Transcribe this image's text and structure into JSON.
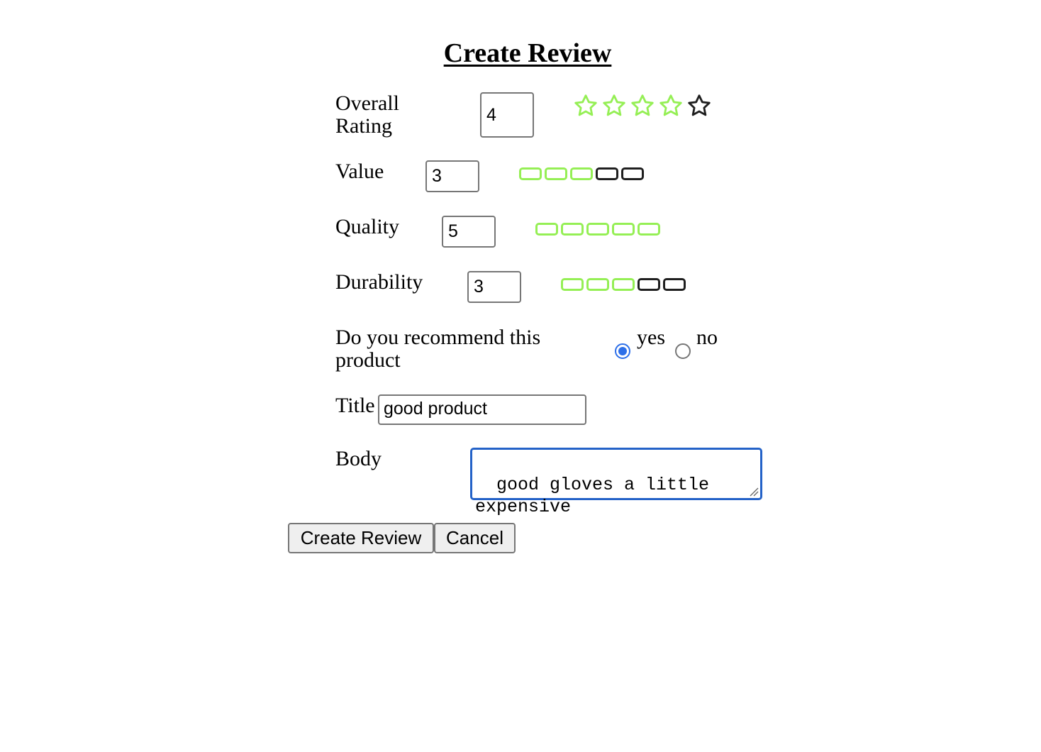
{
  "page": {
    "title": "Create Review"
  },
  "form": {
    "overall": {
      "label": "Overall Rating",
      "value": "4",
      "rating": 4,
      "max": 5
    },
    "value": {
      "label": "Value",
      "value": "3",
      "rating": 3,
      "max": 5
    },
    "quality": {
      "label": "Quality",
      "value": "5",
      "rating": 5,
      "max": 5
    },
    "durability": {
      "label": "Durability",
      "value": "3",
      "rating": 3,
      "max": 5
    },
    "recommend": {
      "label": "Do you recommend this product",
      "options": [
        {
          "label": "yes",
          "checked": true
        },
        {
          "label": "no",
          "checked": false
        }
      ]
    },
    "title": {
      "label": "Title",
      "value": "good product"
    },
    "body": {
      "label": "Body",
      "value": "good gloves a little expensive"
    }
  },
  "buttons": {
    "submit": "Create Review",
    "cancel": "Cancel"
  },
  "colors": {
    "active": "#95ef55",
    "inactive": "#1f1f1f",
    "focus": "#2462c8",
    "radio": "#2d6fe8"
  },
  "icons": {
    "rating": "star-icon",
    "subrating": "rounded-rect-icon",
    "resize": "resize-grip-icon"
  }
}
